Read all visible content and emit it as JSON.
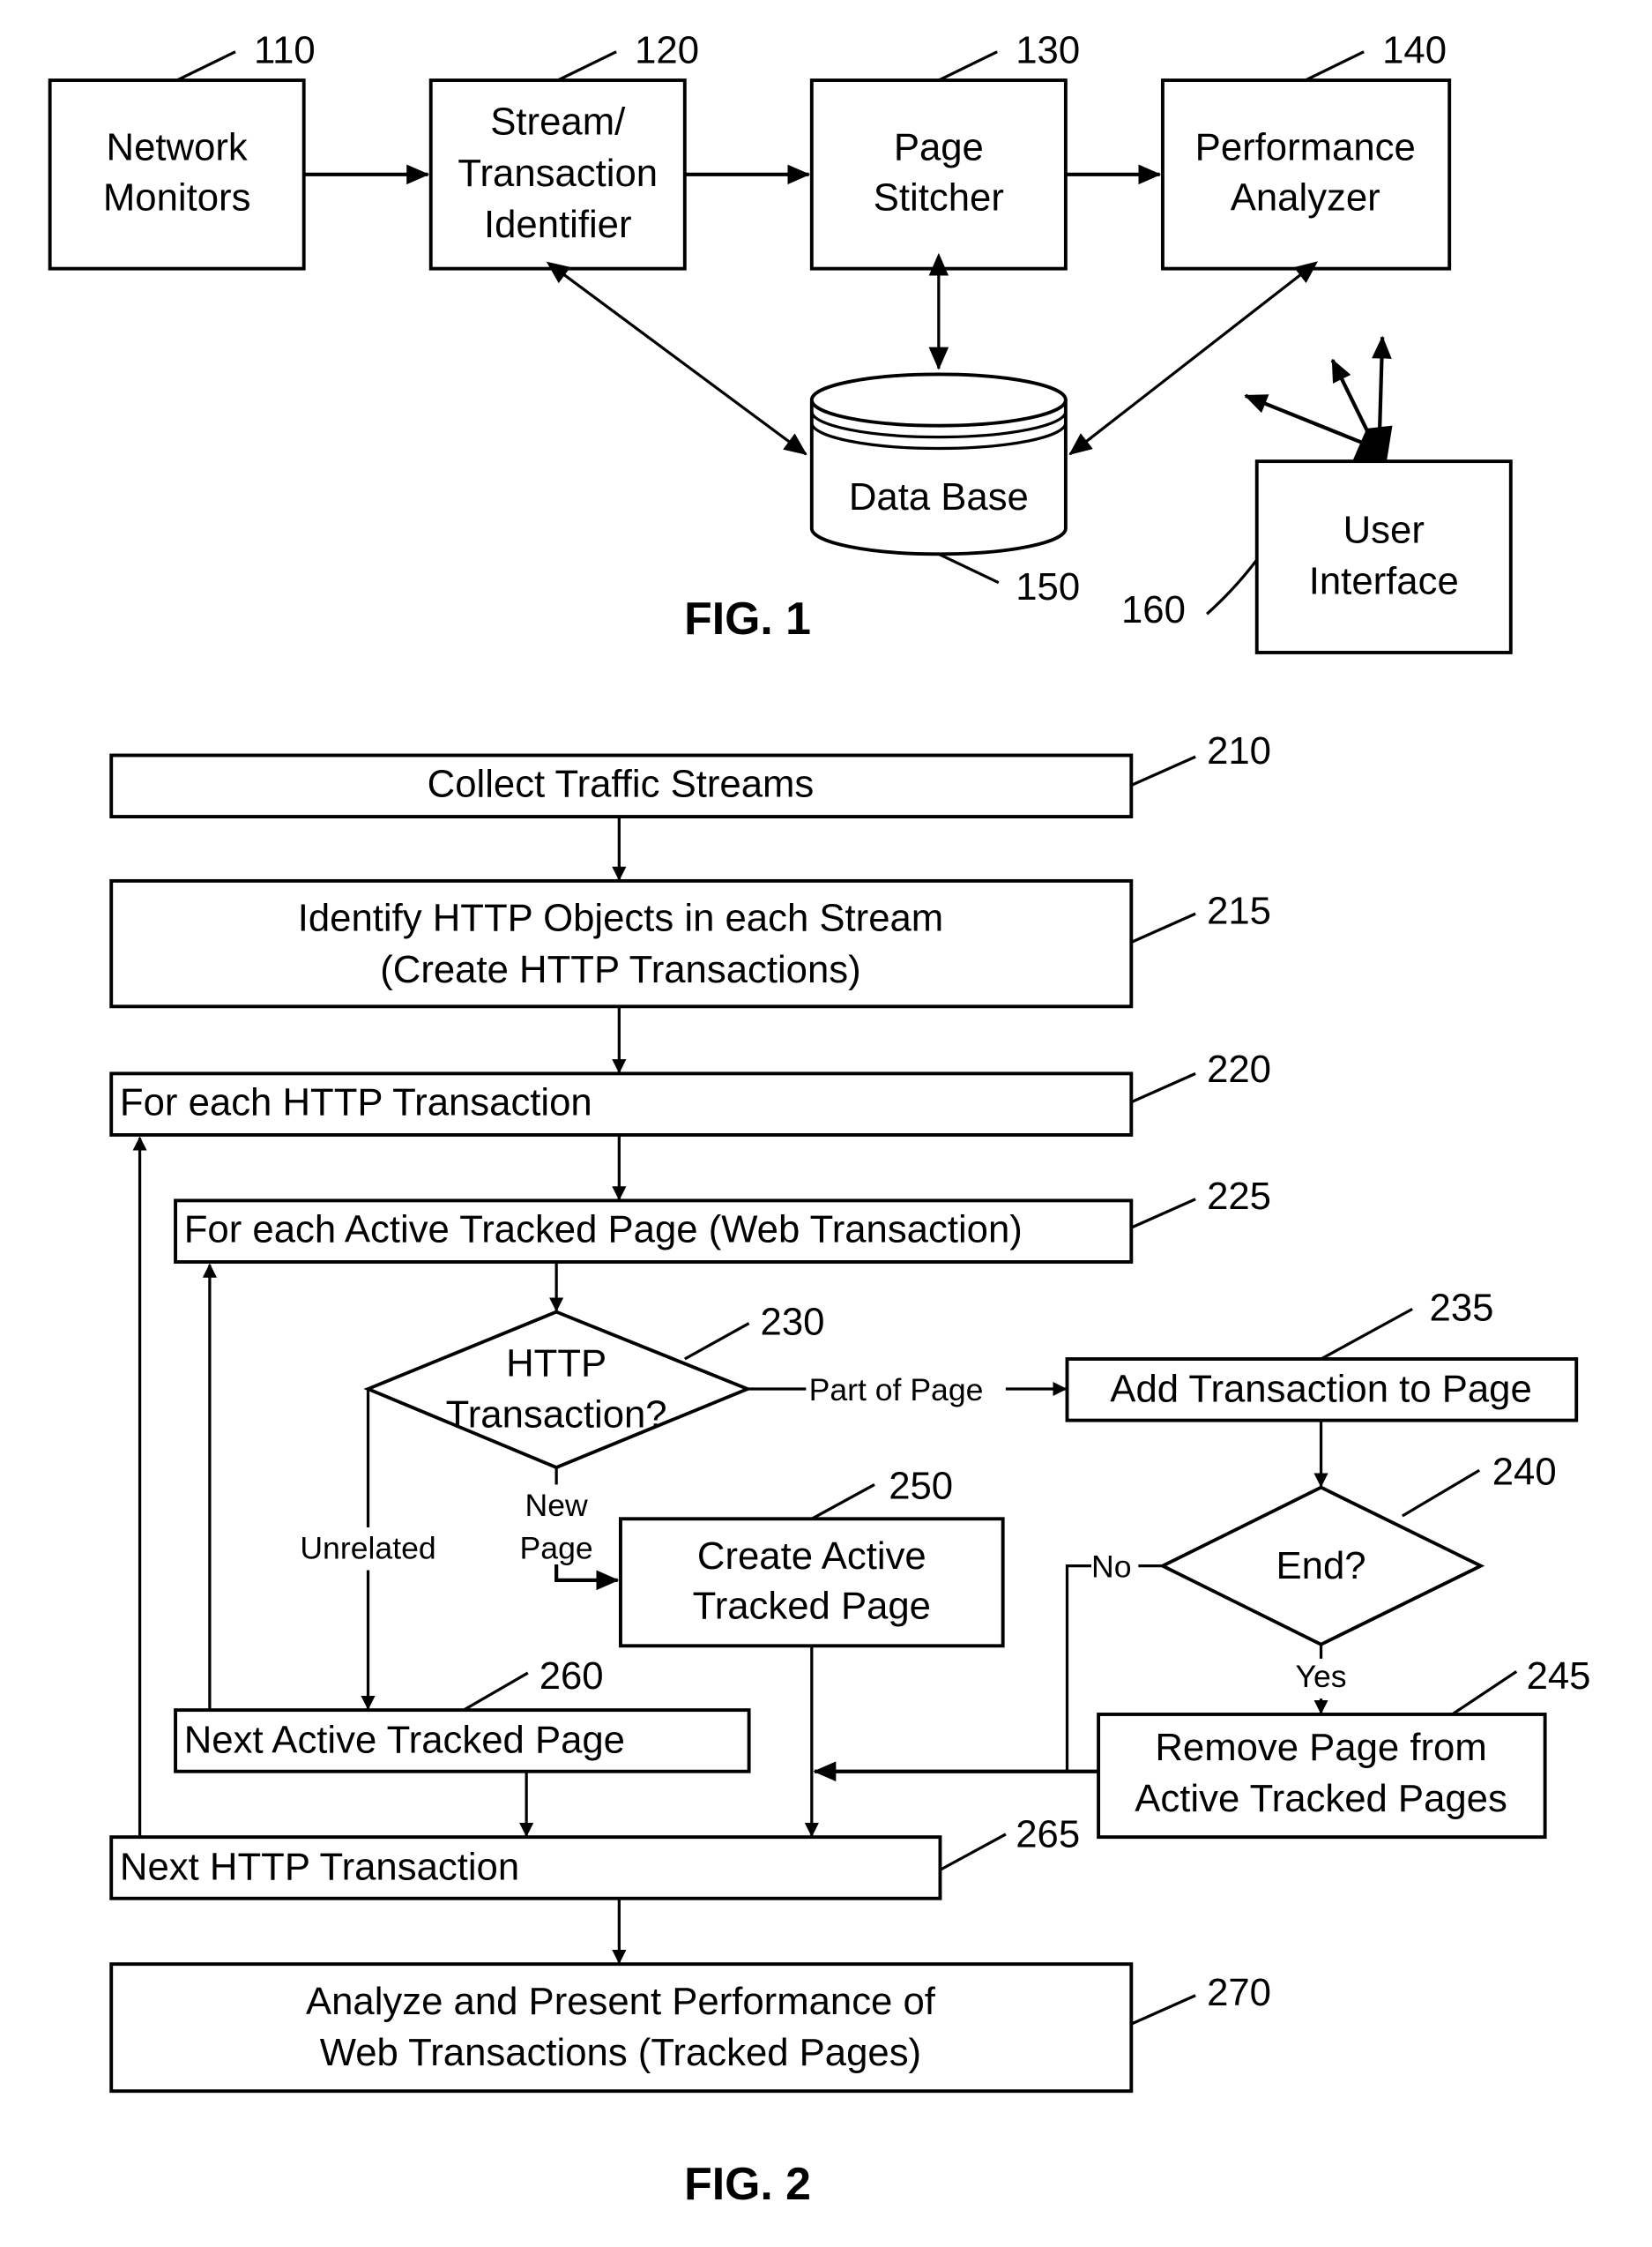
{
  "fig1": {
    "caption": "FIG. 1",
    "blocks": [
      {
        "id": "110",
        "lines": [
          "Network",
          "Monitors"
        ]
      },
      {
        "id": "120",
        "lines": [
          "Stream/",
          "Transaction",
          "Identifier"
        ]
      },
      {
        "id": "130",
        "lines": [
          "Page",
          "Stitcher"
        ]
      },
      {
        "id": "140",
        "lines": [
          "Performance",
          "Analyzer"
        ]
      },
      {
        "id": "150",
        "lines": [
          "Data Base"
        ]
      },
      {
        "id": "160",
        "lines": [
          "User",
          "Interface"
        ]
      }
    ]
  },
  "fig2": {
    "caption": "FIG. 2",
    "steps": [
      {
        "id": "210",
        "lines": [
          "Collect Traffic Streams"
        ]
      },
      {
        "id": "215",
        "lines": [
          "Identify HTTP Objects in each Stream",
          "(Create HTTP Transactions)"
        ]
      },
      {
        "id": "220",
        "lines": [
          "For each HTTP Transaction"
        ]
      },
      {
        "id": "225",
        "lines": [
          "For each Active Tracked Page (Web Transaction)"
        ]
      },
      {
        "id": "230",
        "lines": [
          "HTTP",
          "Transaction?"
        ]
      },
      {
        "id": "235",
        "lines": [
          "Add Transaction to Page"
        ]
      },
      {
        "id": "240",
        "lines": [
          "End?"
        ]
      },
      {
        "id": "245",
        "lines": [
          "Remove Page from",
          "Active Tracked Pages"
        ]
      },
      {
        "id": "250",
        "lines": [
          "Create Active",
          "Tracked Page"
        ]
      },
      {
        "id": "260",
        "lines": [
          "Next Active Tracked Page"
        ]
      },
      {
        "id": "265",
        "lines": [
          "Next HTTP Transaction"
        ]
      },
      {
        "id": "270",
        "lines": [
          "Analyze and Present Performance of",
          "Web Transactions (Tracked Pages)"
        ]
      }
    ],
    "edge_labels": {
      "part_of_page": "Part of Page",
      "new_page_1": "New",
      "new_page_2": "Page",
      "unrelated": "Unrelated",
      "no": "No",
      "yes": "Yes"
    }
  }
}
